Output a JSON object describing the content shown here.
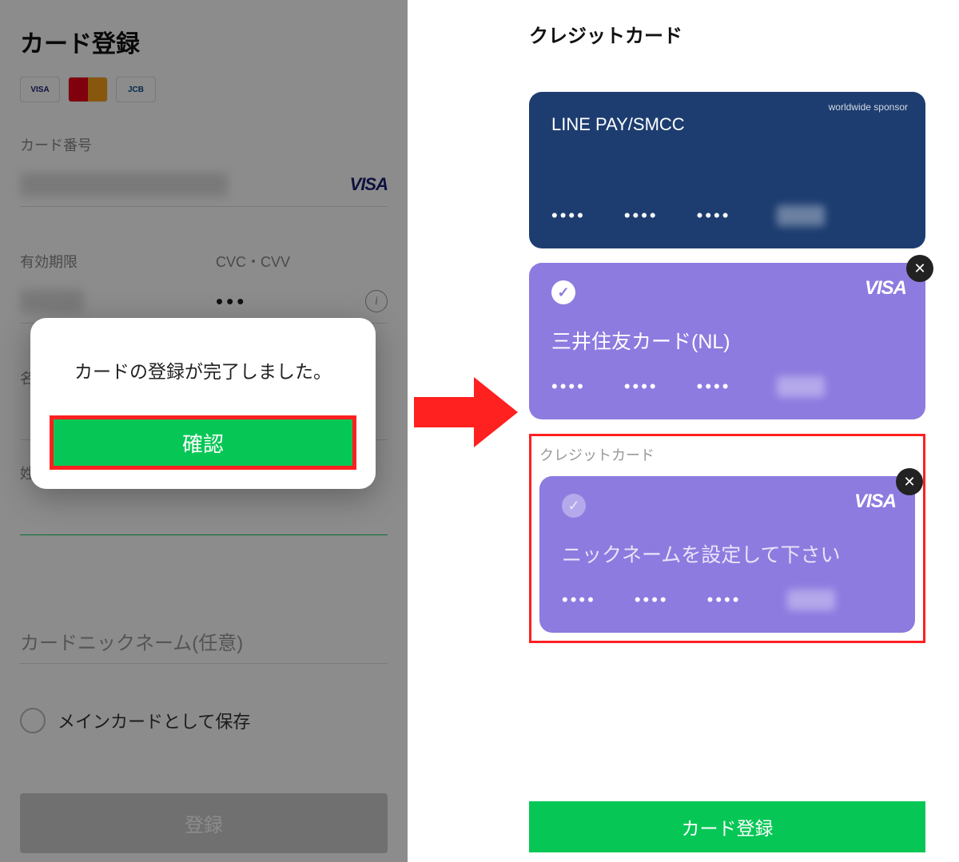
{
  "left": {
    "title": "カード登録",
    "cardNumberLabel": "カード番号",
    "visaBadge": "VISA",
    "expiryLabel": "有効期限",
    "cvcLabel": "CVC・CVV",
    "cvcValue": "•••",
    "nicknameLabel": "カードニックネーム(任意)",
    "mainCardLabel": "メインカードとして保存",
    "registerBtn": "登録"
  },
  "modal": {
    "message": "カードの登録が完了しました。",
    "confirm": "確認"
  },
  "right": {
    "title": "クレジットカード",
    "sectionLabel": "クレジットカード",
    "registerBtn": "カード登録",
    "cards": [
      {
        "sponsor": "worldwide sponsor",
        "name": "LINE PAY/SMCC",
        "dots": "••••"
      },
      {
        "brand": "VISA",
        "name": "三井住友カード(NL)",
        "dots": "••••"
      },
      {
        "brand": "VISA",
        "name": "ニックネームを設定して下さい",
        "dots": "••••"
      }
    ]
  }
}
